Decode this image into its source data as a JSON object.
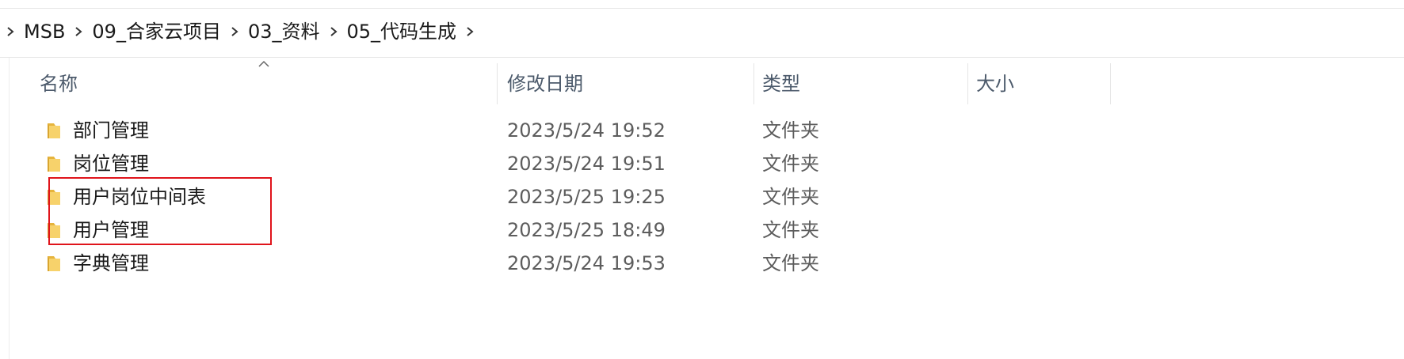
{
  "breadcrumb": {
    "items": [
      "MSB",
      "09_合家云项目",
      "03_资料",
      "05_代码生成"
    ]
  },
  "columns": {
    "name": "名称",
    "date_modified": "修改日期",
    "type": "类型",
    "size": "大小"
  },
  "files": [
    {
      "name": "部门管理",
      "date": "2023/5/24 19:52",
      "type": "文件夹",
      "size": ""
    },
    {
      "name": "岗位管理",
      "date": "2023/5/24 19:51",
      "type": "文件夹",
      "size": ""
    },
    {
      "name": "用户岗位中间表",
      "date": "2023/5/25 19:25",
      "type": "文件夹",
      "size": ""
    },
    {
      "name": "用户管理",
      "date": "2023/5/25 18:49",
      "type": "文件夹",
      "size": ""
    },
    {
      "name": "字典管理",
      "date": "2023/5/24 19:53",
      "type": "文件夹",
      "size": ""
    }
  ],
  "colors": {
    "folder": "#f2c94c",
    "annotation_box": "#e0141b",
    "header_text": "#4c5a6b"
  }
}
